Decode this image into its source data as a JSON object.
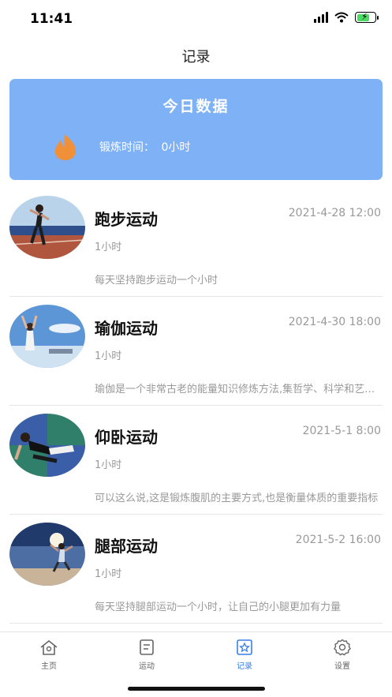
{
  "status_bar": {
    "time": "11:41"
  },
  "header": {
    "title": "记录"
  },
  "today": {
    "title": "今日数据",
    "exercise_label": "锻炼时间：",
    "exercise_value": "0小时"
  },
  "records": [
    {
      "name": "跑步运动",
      "date": "2021-4-28 12:00",
      "duration": "1小时",
      "description": "每天坚持跑步运动一个小时"
    },
    {
      "name": "瑜伽运动",
      "date": "2021-4-30 18:00",
      "duration": "1小时",
      "description": "瑜伽是一个非常古老的能量知识修炼方法,集哲学、科学和艺术于一身"
    },
    {
      "name": "仰卧运动",
      "date": "2021-5-1 8:00",
      "duration": "1小时",
      "description": "可以这么说,这是锻炼腹肌的主要方式,也是衡量体质的重要指标"
    },
    {
      "name": "腿部运动",
      "date": "2021-5-2 16:00",
      "duration": "1小时",
      "description": "每天坚持腿部运动一个小时，让自己的小腿更加有力量"
    }
  ],
  "tabs": [
    {
      "label": "主页",
      "icon": "home-icon"
    },
    {
      "label": "运动",
      "icon": "list-icon"
    },
    {
      "label": "记录",
      "icon": "star-record-icon"
    },
    {
      "label": "设置",
      "icon": "gear-icon"
    }
  ],
  "colors": {
    "card": "#7fb1f7",
    "flame": "#f0913a",
    "active_tab": "#3a7ee8"
  }
}
